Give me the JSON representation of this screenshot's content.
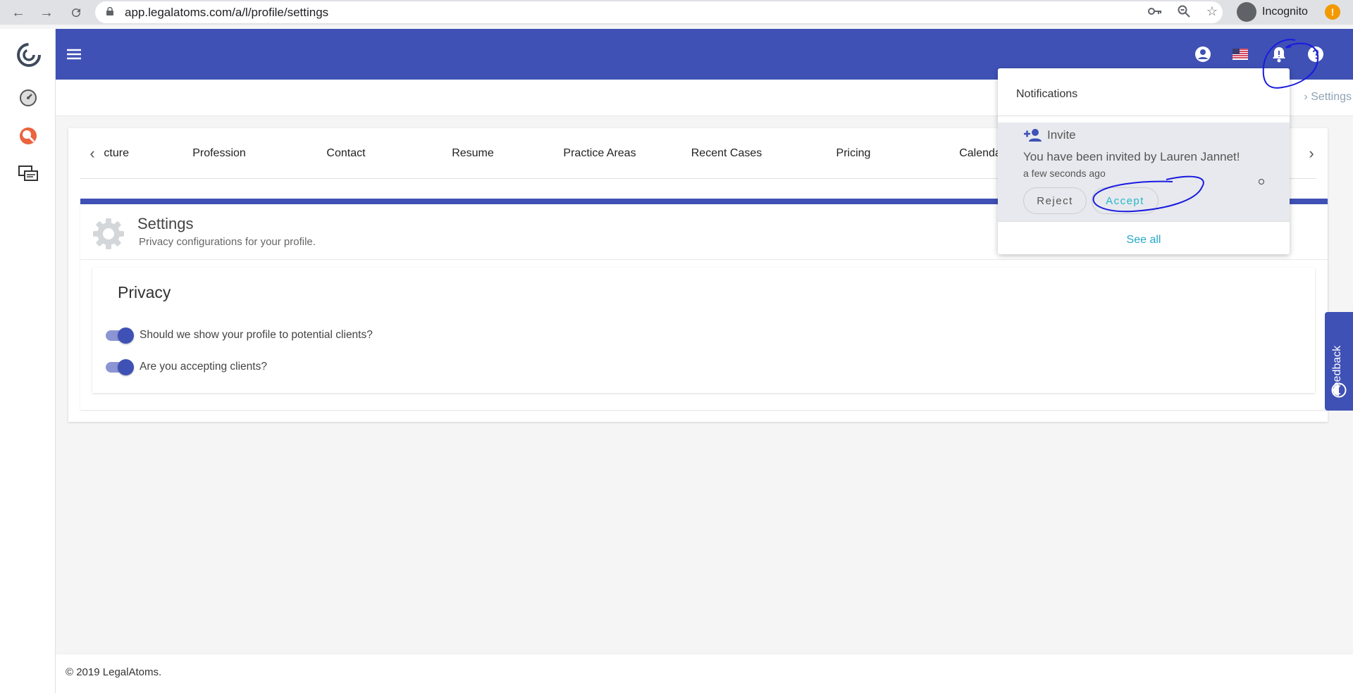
{
  "browser": {
    "url": "app.legalatoms.com/a/l/profile/settings",
    "profile_label": "Incognito",
    "update_badge": "!"
  },
  "breadcrumb": {
    "current": "Settings",
    "separator": "›"
  },
  "tabs": [
    {
      "label": "cture"
    },
    {
      "label": "Profession"
    },
    {
      "label": "Contact"
    },
    {
      "label": "Resume"
    },
    {
      "label": "Practice Areas"
    },
    {
      "label": "Recent Cases"
    },
    {
      "label": "Pricing"
    },
    {
      "label": "Calenda"
    }
  ],
  "settings": {
    "title": "Settings",
    "subtitle": "Privacy configurations for your profile."
  },
  "privacy": {
    "title": "Privacy",
    "toggles": [
      {
        "label": "Should we show your profile to potential clients?",
        "on": true
      },
      {
        "label": "Are you accepting clients?",
        "on": true
      }
    ]
  },
  "notifications": {
    "title": "Notifications",
    "items": [
      {
        "type_label": "Invite",
        "message": "You have been invited by Lauren Jannet!",
        "time": "a few seconds ago",
        "reject_label": "Reject",
        "accept_label": "Accept"
      }
    ],
    "see_all_label": "See all"
  },
  "feedback": {
    "label": "Feedback"
  },
  "footer": {
    "text": "© 2019 LegalAtoms."
  },
  "colors": {
    "primary": "#3f51b5",
    "accent_teal": "#26b6c9",
    "annotation": "#1a1ae0"
  },
  "icons": {
    "header": [
      "account-circle-icon",
      "us-flag-icon",
      "bell-icon",
      "help-icon"
    ],
    "sidebar": [
      "legalatoms-logo-icon",
      "dashboard-icon",
      "search-person-icon",
      "chat-icon"
    ]
  }
}
